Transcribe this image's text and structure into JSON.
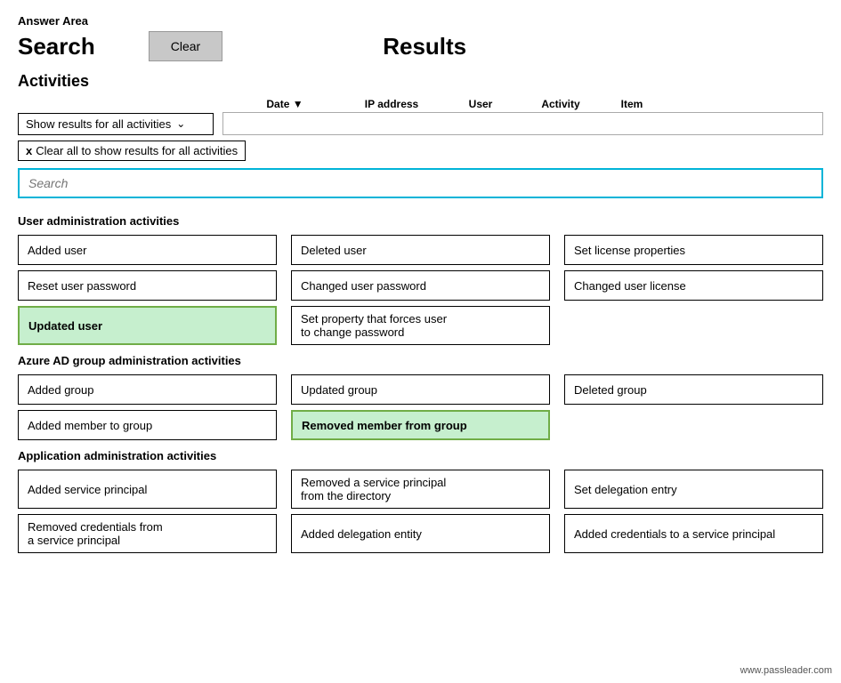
{
  "answerArea": {
    "label": "Answer Area"
  },
  "header": {
    "searchLabel": "Search",
    "clearButton": "Clear",
    "resultsLabel": "Results"
  },
  "activities": {
    "sectionLabel": "Activities",
    "columns": {
      "date": "Date ▼",
      "ipAddress": "IP address",
      "user": "User",
      "activity": "Activity",
      "item": "Item"
    },
    "dropdown": {
      "label": "Show results for all activities",
      "arrow": "⌄"
    },
    "clearAllTag": "x Clear all to show results for all activities",
    "searchPlaceholder": "Search"
  },
  "userAdminSection": {
    "title": "User administration activities",
    "items": [
      {
        "label": "Added user",
        "selected": false,
        "col": 0
      },
      {
        "label": "Deleted user",
        "selected": false,
        "col": 1
      },
      {
        "label": "Set license properties",
        "selected": false,
        "col": 2
      },
      {
        "label": "Reset user password",
        "selected": false,
        "col": 0
      },
      {
        "label": "Changed user password",
        "selected": false,
        "col": 1
      },
      {
        "label": "Changed user license",
        "selected": false,
        "col": 2
      },
      {
        "label": "Updated user",
        "selected": true,
        "col": 0
      },
      {
        "label": "Set property that forces user to change password",
        "selected": false,
        "col": 1
      }
    ]
  },
  "azureAdSection": {
    "title": "Azure AD group administration activities",
    "items": [
      {
        "label": "Added group",
        "selected": false,
        "col": 0
      },
      {
        "label": "Updated group",
        "selected": false,
        "col": 1
      },
      {
        "label": "Deleted group",
        "selected": false,
        "col": 2
      },
      {
        "label": "Added member to group",
        "selected": false,
        "col": 0
      },
      {
        "label": "Removed member from group",
        "selected": true,
        "col": 1
      }
    ]
  },
  "appAdminSection": {
    "title": "Application administration activities",
    "items": [
      {
        "label": "Added service principal",
        "selected": false,
        "col": 0
      },
      {
        "label": "Removed a service principal from the directory",
        "selected": false,
        "col": 1
      },
      {
        "label": "Set delegation entry",
        "selected": false,
        "col": 2
      },
      {
        "label": "Removed credentials from a service principal",
        "selected": false,
        "col": 0
      },
      {
        "label": "Added delegation entity",
        "selected": false,
        "col": 1
      },
      {
        "label": "Added credentials to a service principal",
        "selected": false,
        "col": 2
      }
    ]
  },
  "watermark": "www.passleader.com"
}
